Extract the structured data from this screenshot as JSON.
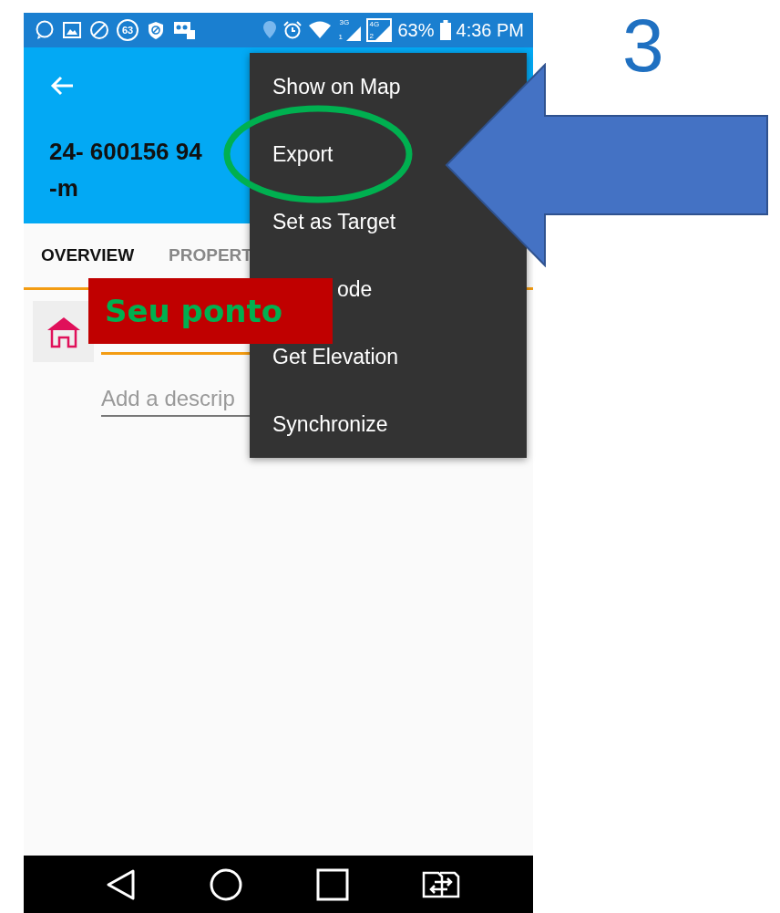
{
  "status_bar": {
    "badge": "63",
    "signals": [
      {
        "network": "3G",
        "sim": "1"
      },
      {
        "network": "4G",
        "sim": "2"
      }
    ],
    "battery": "63%",
    "time": "4:36 PM"
  },
  "app_bar": {
    "title_lines": [
      "24- 600156 94",
      "-m"
    ]
  },
  "tabs": [
    {
      "label": "OVERVIEW",
      "selected": true
    },
    {
      "label": "PROPERT",
      "selected": false
    }
  ],
  "form": {
    "description": {
      "placeholder": "Add a descrip"
    }
  },
  "menu": [
    {
      "label": "Show on Map",
      "kind": "plain"
    },
    {
      "label": "Export",
      "kind": "plain"
    },
    {
      "label": "Set as Target",
      "kind": "plain"
    },
    {
      "label": "ode",
      "kind": "covered"
    },
    {
      "label": "Get Elevation",
      "kind": "plain"
    },
    {
      "label": "Synchronize",
      "kind": "plain"
    }
  ],
  "annotations": {
    "step": "3",
    "callout": "Seu ponto"
  }
}
